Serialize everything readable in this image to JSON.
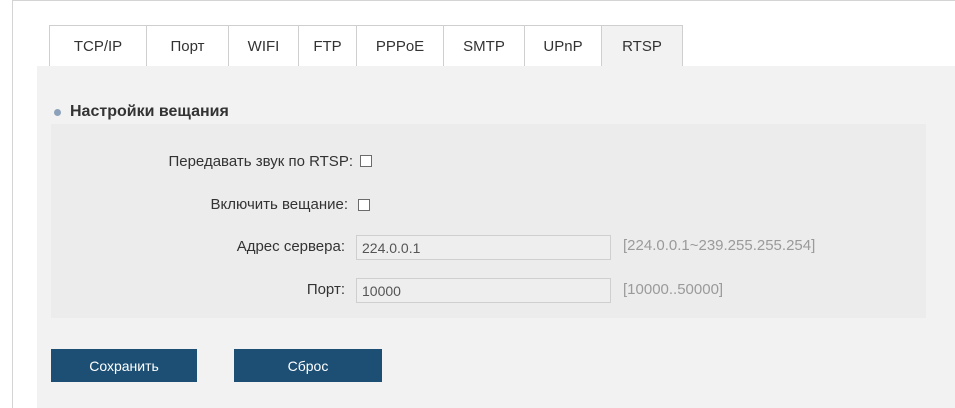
{
  "tabs": [
    {
      "label": "TCP/IP"
    },
    {
      "label": "Порт"
    },
    {
      "label": "WIFI"
    },
    {
      "label": "FTP"
    },
    {
      "label": "PPPoE"
    },
    {
      "label": "SMTP"
    },
    {
      "label": "UPnP"
    },
    {
      "label": "RTSP"
    }
  ],
  "active_tab": "RTSP",
  "section": {
    "title": "Настройки вещания"
  },
  "form": {
    "rtsp_audio": {
      "label": "Передавать звук по RTSP:",
      "checked": false
    },
    "broadcast": {
      "label": "Включить вещание:",
      "checked": false
    },
    "server_address": {
      "label": "Адрес сервера:",
      "value": "224.0.0.1",
      "hint": "[224.0.0.1~239.255.255.254]"
    },
    "port": {
      "label": "Порт:",
      "value": "10000",
      "hint": "[10000..50000]"
    }
  },
  "buttons": {
    "save": "Сохранить",
    "reset": "Сброс"
  },
  "colors": {
    "button": "#1d4f75",
    "panel": "#f2f2f2",
    "bullet": "#8da2ba"
  }
}
